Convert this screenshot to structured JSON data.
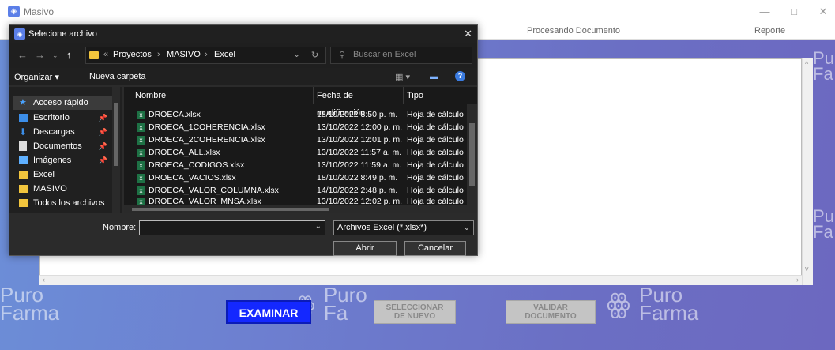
{
  "window": {
    "title": "Masivo",
    "minimize": "—",
    "maximize": "□",
    "close": "✕"
  },
  "tabs": [
    "Procesando Documento",
    "Reporte"
  ],
  "watermarks": {
    "left": [
      "Puro",
      "Farma"
    ],
    "center": [
      "Puro",
      "Fa"
    ],
    "right": [
      "Puro",
      "Farma"
    ],
    "edge_top": [
      "Pu",
      "Fa"
    ],
    "edge_mid": [
      "Pu",
      "Fa"
    ]
  },
  "buttons": {
    "examinar": "EXAMINAR",
    "seleccionar": [
      "SELECCIONAR",
      "DE NUEVO"
    ],
    "validar": [
      "VALIDAR",
      "DOCUMENTO"
    ]
  },
  "dialog": {
    "title": "Selecione archivo",
    "close": "✕",
    "path": [
      "Proyectos",
      "MASIVO",
      "Excel"
    ],
    "path_prefix": "«",
    "path_sep": "›",
    "search_placeholder": "Buscar en Excel",
    "organize": "Organizar ▾",
    "new_folder": "Nueva carpeta",
    "nav_items": [
      {
        "label": "Acceso rápido",
        "icon": "star-icon",
        "color": "#4aa3ff"
      },
      {
        "label": "Escritorio",
        "icon": "desktop-icon",
        "color": "#3c8ee8"
      },
      {
        "label": "Descargas",
        "icon": "download-icon",
        "color": "#3c8ee8"
      },
      {
        "label": "Documentos",
        "icon": "document-icon",
        "color": "#dddddd"
      },
      {
        "label": "Imágenes",
        "icon": "image-icon",
        "color": "#5fb0ff"
      },
      {
        "label": "Excel",
        "icon": "folder-icon",
        "color": "#f2c53d"
      },
      {
        "label": "MASIVO",
        "icon": "folder-icon",
        "color": "#f2c53d"
      },
      {
        "label": "Todos los archivos",
        "icon": "folder-icon",
        "color": "#f2c53d"
      }
    ],
    "columns": [
      "Nombre",
      "Fecha de modificación",
      "Tipo"
    ],
    "files": [
      {
        "name": "DROECA.xlsx",
        "date": "18/10/2022 8:50 p. m.",
        "type": "Hoja de cálculo"
      },
      {
        "name": "DROECA_1COHERENCIA.xlsx",
        "date": "13/10/2022 12:00 p. m.",
        "type": "Hoja de cálculo"
      },
      {
        "name": "DROECA_2COHERENCIA.xlsx",
        "date": "13/10/2022 12:01 p. m.",
        "type": "Hoja de cálculo"
      },
      {
        "name": "DROECA_ALL.xlsx",
        "date": "13/10/2022 11:57 a. m.",
        "type": "Hoja de cálculo"
      },
      {
        "name": "DROECA_CODIGOS.xlsx",
        "date": "13/10/2022 11:59 a. m.",
        "type": "Hoja de cálculo"
      },
      {
        "name": "DROECA_VACIOS.xlsx",
        "date": "18/10/2022 8:49 p. m.",
        "type": "Hoja de cálculo"
      },
      {
        "name": "DROECA_VALOR_COLUMNA.xlsx",
        "date": "14/10/2022 2:48 p. m.",
        "type": "Hoja de cálculo"
      },
      {
        "name": "DROECA_VALOR_MNSA.xlsx",
        "date": "13/10/2022 12:02 p. m.",
        "type": "Hoja de cálculo"
      }
    ],
    "name_label": "Nombre:",
    "name_value": "",
    "filter": "Archivos Excel (*.xlsx*)",
    "open": "Abrir",
    "cancel": "Cancelar"
  },
  "colors": {
    "examinar_bg": "#1428ff",
    "dialog_bg": "#2b2b2b",
    "gradient_start": "#6c8fd8",
    "gradient_end": "#6c68c0"
  }
}
